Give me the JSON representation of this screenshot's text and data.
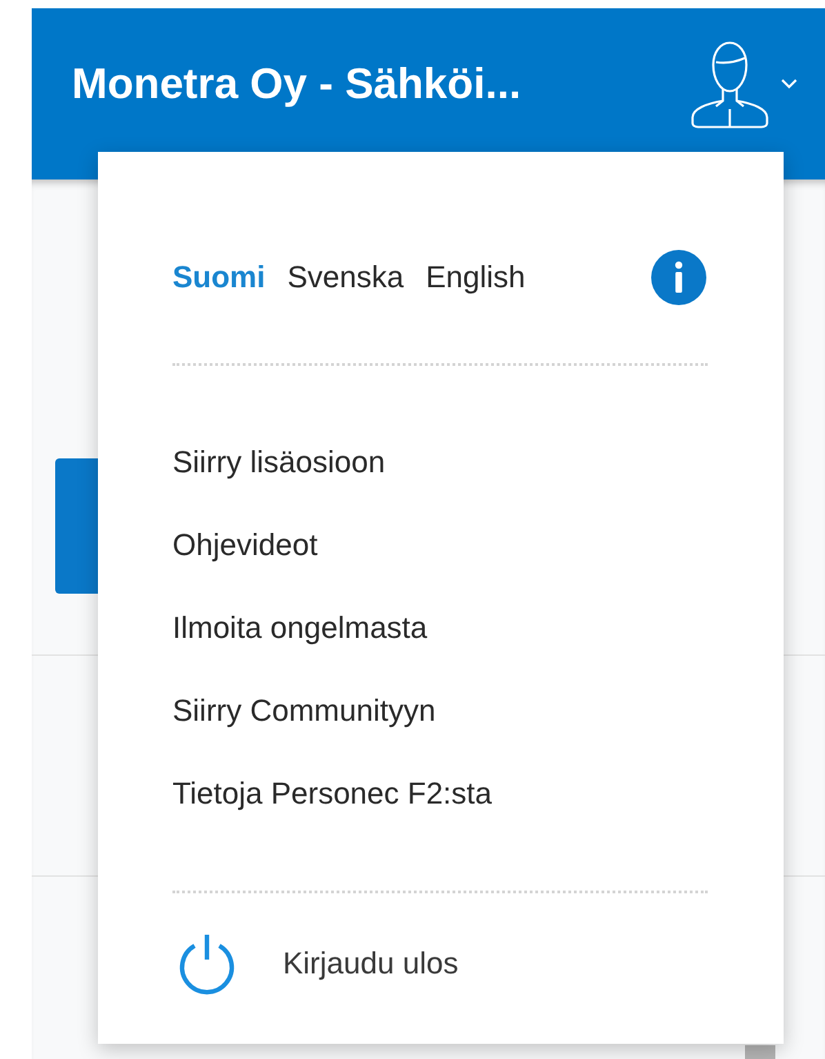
{
  "header": {
    "title": "Monetra Oy - Sähköi..."
  },
  "menu": {
    "languages": [
      {
        "label": "Suomi",
        "selected": true
      },
      {
        "label": "Svenska",
        "selected": false
      },
      {
        "label": "English",
        "selected": false
      }
    ],
    "items": [
      "Siirry lisäosioon",
      "Ohjevideot",
      "Ilmoita ongelmasta",
      "Siirry Communityyn",
      "Tietoja Personec F2:sta"
    ],
    "logout": "Kirjaudu ulos"
  }
}
